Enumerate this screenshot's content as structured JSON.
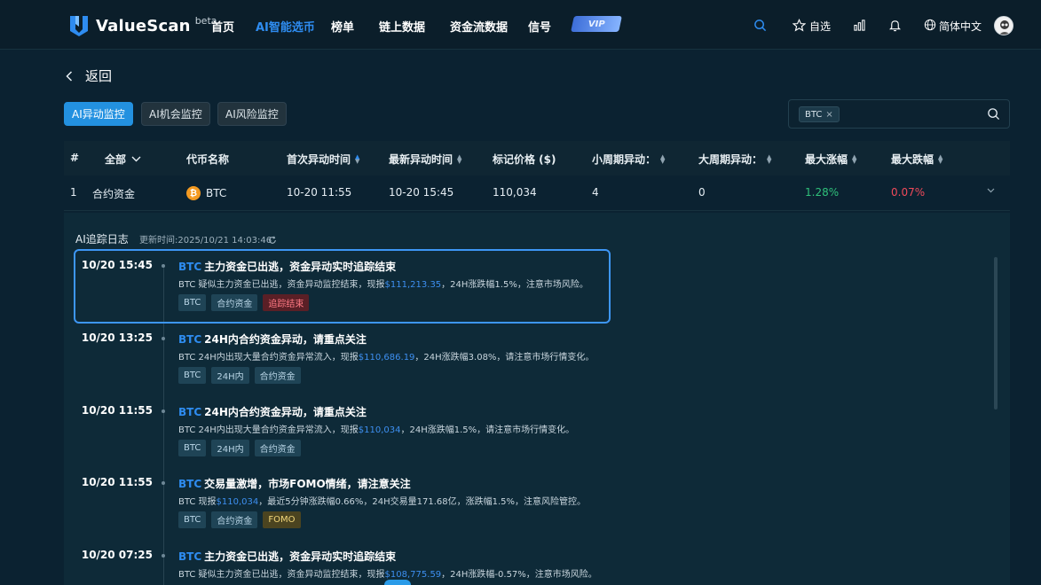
{
  "header": {
    "brand": "ValueScan",
    "beta": "beta",
    "nav": [
      {
        "label": "首页",
        "active": false
      },
      {
        "label": "AI智能选币",
        "active": true
      },
      {
        "label": "榜单",
        "active": false
      },
      {
        "label": "链上数据",
        "active": false
      },
      {
        "label": "资金流数据",
        "active": false
      },
      {
        "label": "信号",
        "active": false
      }
    ],
    "vip": "VIP",
    "favorites": "自选",
    "language": "简体中文"
  },
  "back_label": "返回",
  "tabs": [
    {
      "label": "AI异动监控",
      "active": true
    },
    {
      "label": "AI机会监控",
      "active": false
    },
    {
      "label": "AI风险监控",
      "active": false
    }
  ],
  "search": {
    "chip": "BTC",
    "chip_close": "×"
  },
  "table": {
    "columns": [
      "#",
      "全部",
      "代币名称",
      "首次异动时间",
      "最新异动时间",
      "标记价格 ($)",
      "小周期异动：",
      "大周期异动：",
      "最大涨幅",
      "最大跌幅"
    ],
    "row": {
      "index": "1",
      "type": "合约资金",
      "coin": "BTC",
      "first_time": "10-20 11:55",
      "latest_time": "10-20 15:45",
      "price": "110,034",
      "small_cycle": "4",
      "large_cycle": "0",
      "max_rise": "1.28%",
      "max_fall": "0.07%"
    }
  },
  "log": {
    "title": "AI追踪日志",
    "updated": "更新时间:2025/10/21 14:03:46",
    "entries": [
      {
        "time": "10/20 15:45",
        "sym": "BTC",
        "title": "主力资金已出逃，资金异动实时追踪结束",
        "desc_a": "BTC 疑似主力资金已出逃，资金异动监控结束，现报",
        "price": "$111,213.35",
        "desc_b": "，24H涨跌幅1.5%，注意市场风险。",
        "tags": [
          {
            "t": "BTC",
            "c": ""
          },
          {
            "t": "合约资金",
            "c": ""
          },
          {
            "t": "追踪结束",
            "c": "red"
          }
        ]
      },
      {
        "time": "10/20 13:25",
        "sym": "BTC",
        "title": "24H内合约资金异动，请重点关注",
        "desc_a": "BTC 24H内出现大量合约资金异常流入，现报",
        "price": "$110,686.19",
        "desc_b": "，24H涨跌幅3.08%，请注意市场行情变化。",
        "tags": [
          {
            "t": "BTC",
            "c": ""
          },
          {
            "t": "24H内",
            "c": ""
          },
          {
            "t": "合约资金",
            "c": ""
          }
        ]
      },
      {
        "time": "10/20 11:55",
        "sym": "BTC",
        "title": "24H内合约资金异动，请重点关注",
        "desc_a": "BTC 24H内出现大量合约资金异常流入，现报",
        "price": "$110,034",
        "desc_b": "，24H涨跌幅1.5%，请注意市场行情变化。",
        "tags": [
          {
            "t": "BTC",
            "c": ""
          },
          {
            "t": "24H内",
            "c": ""
          },
          {
            "t": "合约资金",
            "c": ""
          }
        ]
      },
      {
        "time": "10/20 11:55",
        "sym": "BTC",
        "title": "交易量激增，市场FOMO情绪，请注意关注",
        "desc_a": "BTC 现报",
        "price": "$110,034",
        "desc_b": "，最近5分钟涨跌幅0.66%，24H交易量171.68亿，涨跌幅1.5%，注意风险管控。",
        "tags": [
          {
            "t": "BTC",
            "c": ""
          },
          {
            "t": "合约资金",
            "c": ""
          },
          {
            "t": "FOMO",
            "c": "yellow"
          }
        ]
      },
      {
        "time": "10/20 07:25",
        "sym": "BTC",
        "title": "主力资金已出逃，资金异动实时追踪结束",
        "desc_a": "BTC 疑似主力资金已出逃，资金异动监控结束，现报",
        "price": "$108,775.59",
        "desc_b": "，24H涨跌幅-0.57%，注意市场风险。",
        "tags": []
      }
    ]
  }
}
